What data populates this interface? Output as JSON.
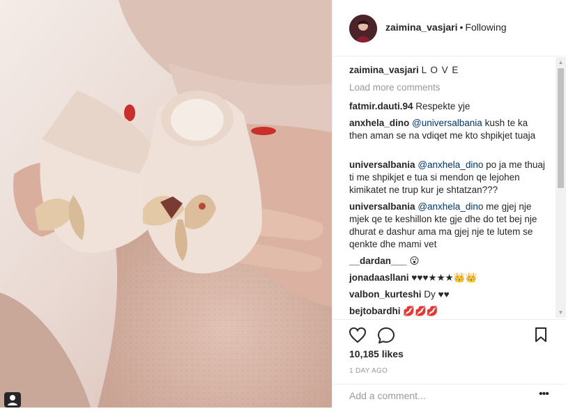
{
  "post": {
    "username": "zaimina_vasjari",
    "follow_status": "Following",
    "caption_text": "L O V E",
    "load_more": "Load more comments",
    "comments": [
      {
        "user": "fatmir.dauti.94",
        "mention": "",
        "text": "Respekte yje"
      },
      {
        "user": "anxhela_dino",
        "mention": "@universalbania",
        "text": "kush te ka then aman se na vdiqet me kto shpikjet tuaja"
      },
      {
        "user": "universalbania",
        "mention": "@anxhela_dino",
        "text": "po ja me thuaj ti me shpikjet e tua si mendon qe lejohen kimikatet ne trup kur je shtatzan???"
      },
      {
        "user": "universalbania",
        "mention": "@anxhela_dino",
        "text": "me gjej nje mjek qe te keshillon kte gje dhe do tet bej nje dhurat e dashur ama ma gjej nje te lutem se qenkte dhe mami vet"
      },
      {
        "user": "__dardan___",
        "mention": "",
        "text": "😮"
      },
      {
        "user": "jonadaasllani",
        "mention": "",
        "text": "♥♥♥★★★👑👑"
      },
      {
        "user": "valbon_kurteshi",
        "mention": "",
        "text": "Dy ♥♥"
      },
      {
        "user": "bejtobardhi",
        "mention": "",
        "text": "💋💋💋"
      }
    ],
    "likes": "10,185 likes",
    "time_ago": "1 DAY AGO",
    "add_comment_placeholder": "Add a comment...",
    "more_glyph": "•••"
  },
  "icons": {
    "like": "heart-outline-icon",
    "comment": "speech-bubble-icon",
    "save": "bookmark-icon",
    "tag": "user-tag-icon"
  },
  "colors": {
    "text": "#262626",
    "muted": "#999999",
    "mention": "#003569",
    "border": "#efefef"
  }
}
